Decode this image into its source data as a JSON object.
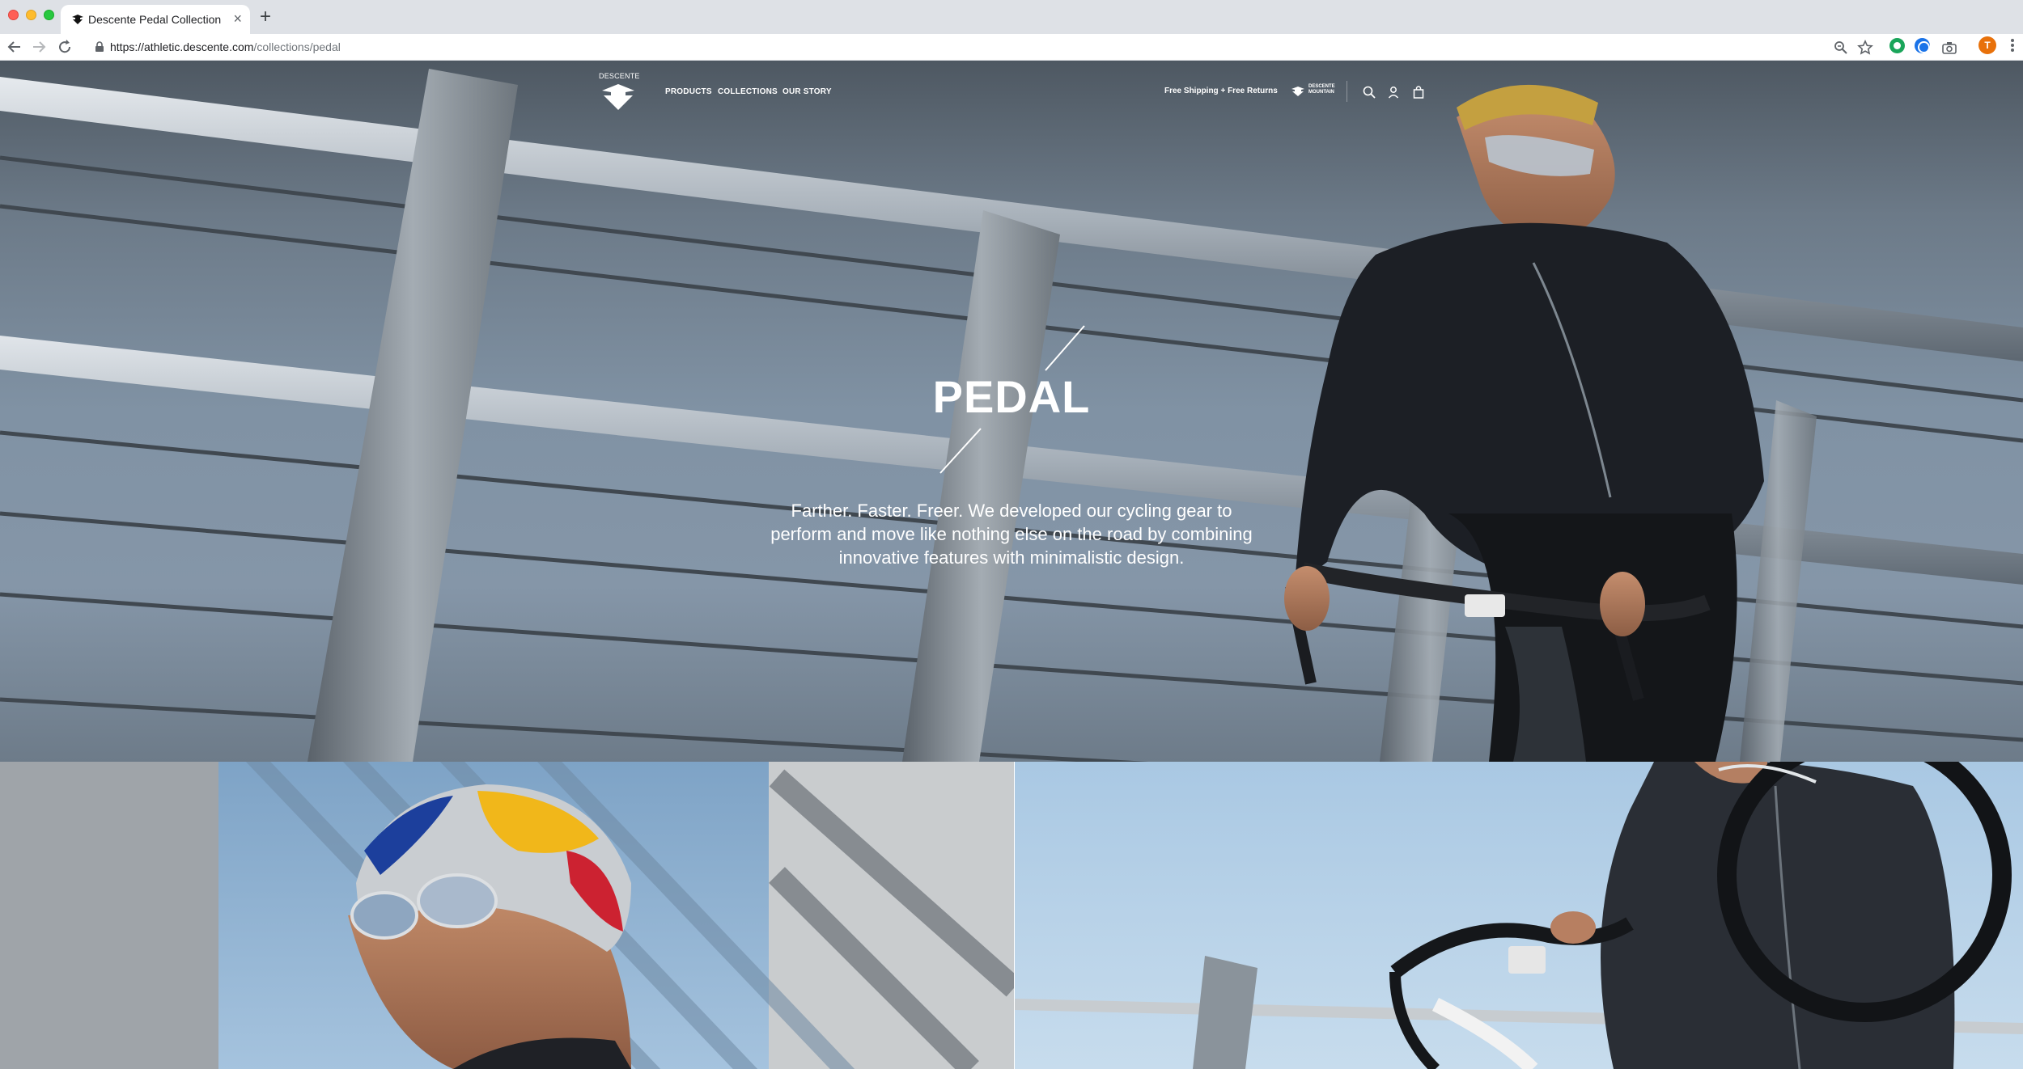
{
  "browser": {
    "tab_title": "Descente Pedal Collection",
    "new_tab_symbol": "+",
    "close_symbol": "×",
    "url_host": "https://athletic.descente.com",
    "url_path": "/collections/pedal",
    "profile_initial": "T"
  },
  "header": {
    "logo_text": "DESCENTE",
    "nav": [
      "PRODUCTS",
      "COLLECTIONS",
      "OUR STORY"
    ],
    "promo": "Free Shipping + Free Returns",
    "sub_brand_lines": [
      "DESCENTE",
      "MOUNTAIN"
    ]
  },
  "hero": {
    "title": "PEDAL",
    "description": "Farther. Faster. Freer. We developed our cycling gear to perform and move like nothing else on the road by combining innovative features with minimalistic design."
  },
  "icons": {
    "browser": [
      "back-icon",
      "forward-icon",
      "reload-icon",
      "lock-icon",
      "zoom-icon",
      "star-icon",
      "extension-icon",
      "camera-icon",
      "menu-icon"
    ],
    "site": [
      "search-icon",
      "account-icon",
      "bag-icon"
    ]
  },
  "colors": {
    "tabbar": "#dee1e6",
    "hero_overlay_text": "#ffffff",
    "jersey": "#1c1f25",
    "sky_blue": "#a9c8e3"
  }
}
